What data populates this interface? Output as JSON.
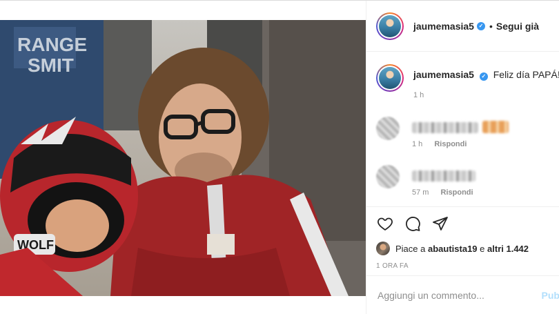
{
  "post": {
    "author": "jaumemasia5",
    "follow_status": "Segui già",
    "caption_text": "Feliz día PAPÁ!",
    "caption_emoji": "❤",
    "caption_time": "1 h"
  },
  "comments": [
    {
      "time": "1 h",
      "reply_label": "Rispondi"
    },
    {
      "time": "57 m",
      "reply_label": "Rispondi"
    }
  ],
  "likes": {
    "prefix": "Piace a",
    "user": "abautista19",
    "conjunction": "e",
    "others": "altri 1.442"
  },
  "post_time": "1 ORA FA",
  "comment_box": {
    "placeholder": "Aggiungi un commento...",
    "publish_label": "Pub"
  },
  "icons": {
    "like": "heart-icon",
    "comment": "comment-icon",
    "share": "share-icon",
    "verified": "verified-badge-icon"
  },
  "colors": {
    "verified_blue": "#3897f0",
    "heart_red": "#e0245e",
    "publish_disabled": "#b2dffc"
  }
}
